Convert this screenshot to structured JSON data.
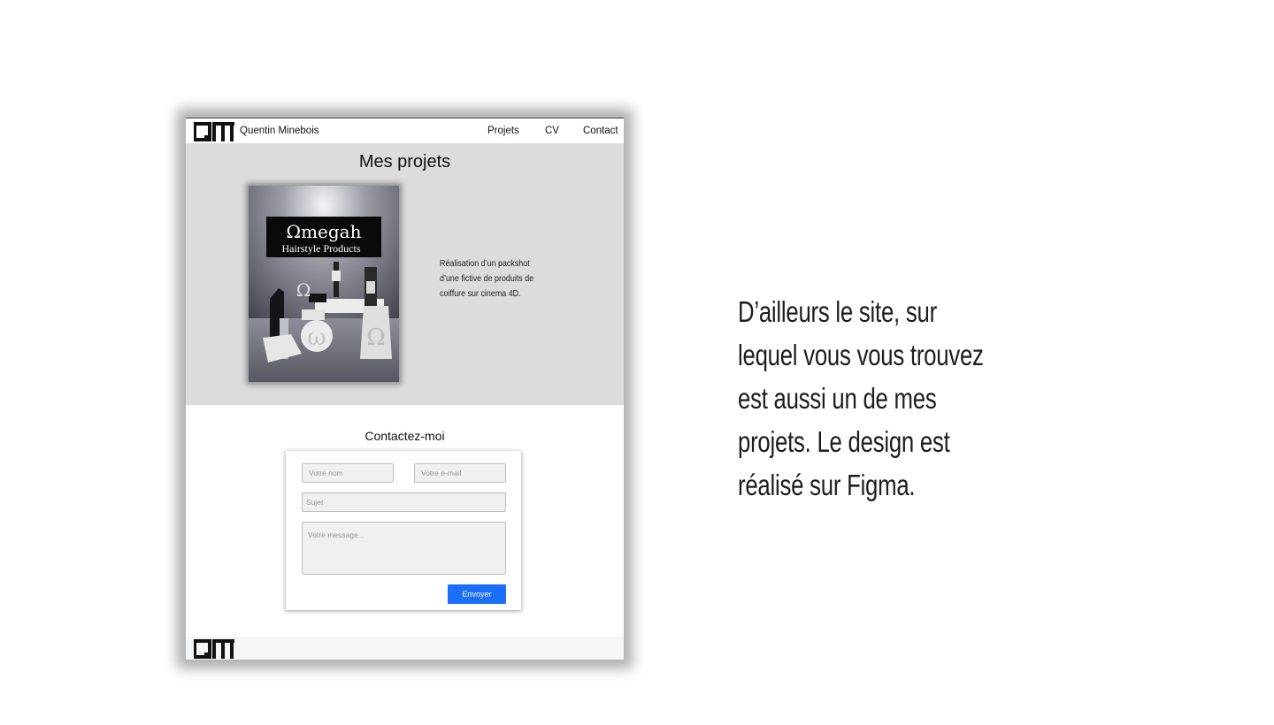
{
  "header": {
    "brand_name": "Quentin Minebois",
    "nav": [
      {
        "label": "Projets"
      },
      {
        "label": "CV"
      },
      {
        "label": "Contact"
      }
    ]
  },
  "projects": {
    "title": "Mes projets",
    "items": [
      {
        "image_brand": "Ωmegah",
        "image_tagline": "Hairstyle Products",
        "description": "Réalisation d’un packshot d’une fictive de produits de coiffure sur cinema 4D."
      }
    ]
  },
  "contact": {
    "title": "Contactez-moi",
    "name_placeholder": "Votre nom",
    "email_placeholder": "Votre e-mail",
    "subject_placeholder": "Sujet",
    "message_placeholder": "Votre message...",
    "send_label": "Envoyer",
    "accent_color": "#1a6ef7"
  },
  "slide": {
    "text": "D’ailleurs le site, sur lequel vous vous trouvez est aussi un de mes projets. Le design est réalisé sur Figma."
  }
}
